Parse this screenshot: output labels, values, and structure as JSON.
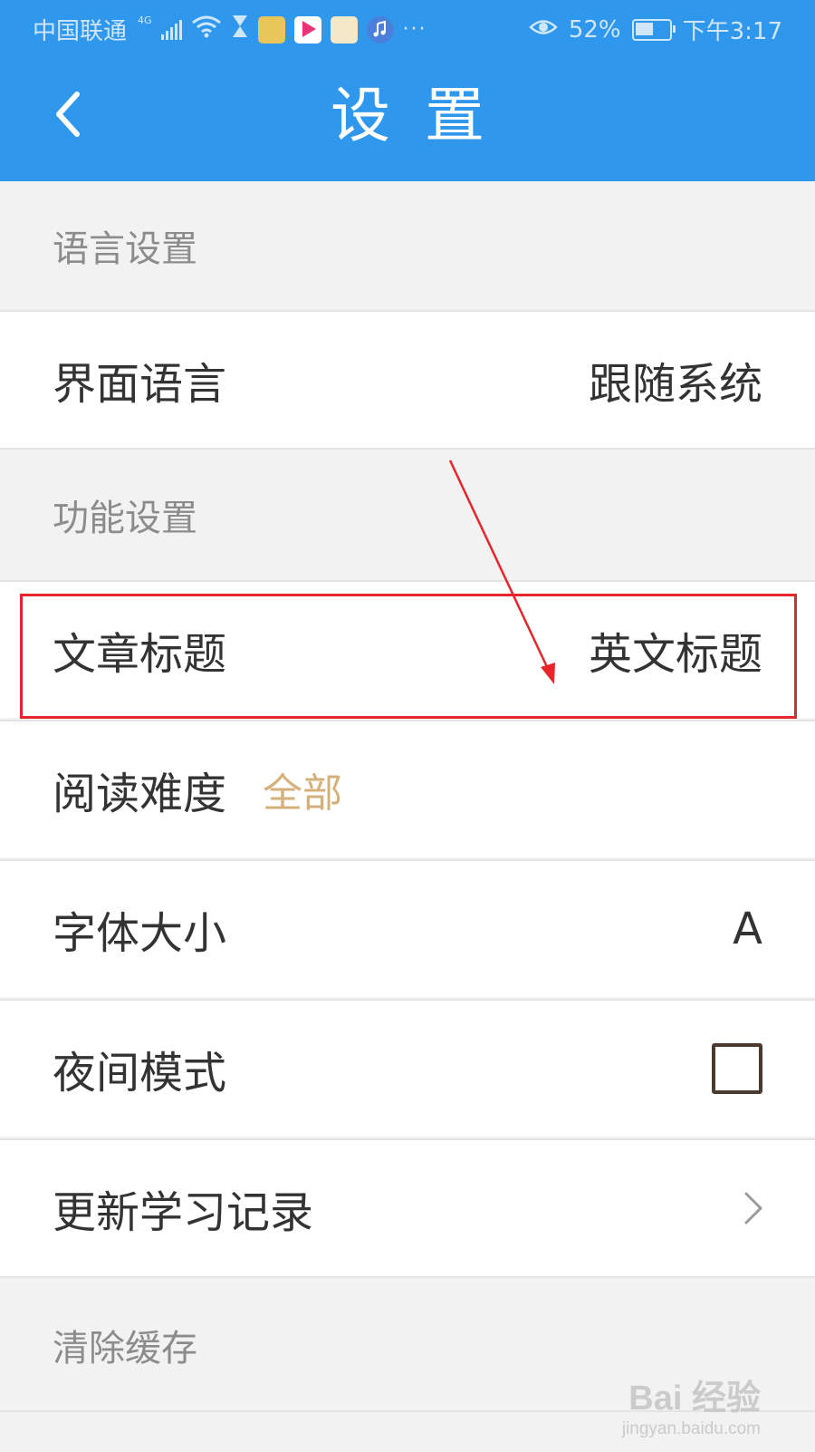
{
  "status_bar": {
    "carrier": "中国联通",
    "network": "4G",
    "battery_percent": "52%",
    "battery_level": 0.52,
    "time": "下午3:17",
    "more": "···",
    "icons": [
      "signal-icon",
      "wifi-icon",
      "hourglass-icon",
      "app-icon-1",
      "youku-app-icon",
      "app-icon-3",
      "music-app-icon",
      "eye-icon",
      "battery-icon"
    ]
  },
  "title_bar": {
    "back_icon": "chevron-left-icon",
    "title": "设置"
  },
  "settings": {
    "language_section": {
      "header": "语言设置",
      "interface_language": {
        "label": "界面语言",
        "value": "跟随系统"
      }
    },
    "function_section": {
      "header": "功能设置",
      "article_title": {
        "label": "文章标题",
        "value": "英文标题"
      },
      "reading_difficulty": {
        "label": "阅读难度",
        "value": "全部"
      },
      "font_size": {
        "label": "字体大小",
        "value": "A"
      },
      "night_mode": {
        "label": "夜间模式",
        "checked": false
      },
      "update_records": {
        "label": "更新学习记录",
        "icon": "chevron-right-icon"
      }
    },
    "cache_section": {
      "header": "清除缓存"
    }
  },
  "annotation": {
    "box_color": "#e8252b",
    "arrow_color": "#e8252b"
  },
  "watermark": {
    "main": "Bai 经验",
    "sub": "jingyan.baidu.com"
  },
  "colors": {
    "header_bg": "#2f97ec",
    "page_bg": "#f2f2f2",
    "tag": "#d4b07a"
  }
}
